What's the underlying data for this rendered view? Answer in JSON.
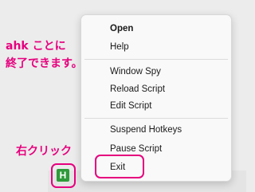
{
  "annotations": {
    "note_line1": "ahk ことに",
    "note_line2": "終了できます。",
    "right_click": "右クリック",
    "accent_color": "#e6007e"
  },
  "menu": {
    "items": [
      {
        "label": "Open",
        "bold": true
      },
      {
        "label": "Help"
      },
      {
        "label": "Window Spy"
      },
      {
        "label": "Reload Script"
      },
      {
        "label": "Edit Script"
      },
      {
        "label": "Suspend Hotkeys"
      },
      {
        "label": "Pause Script"
      },
      {
        "label": "Exit"
      }
    ]
  },
  "tray": {
    "icon_letter": "H",
    "icon_name": "autohotkey-tray-icon",
    "icon_color": "#2e9b3a"
  }
}
